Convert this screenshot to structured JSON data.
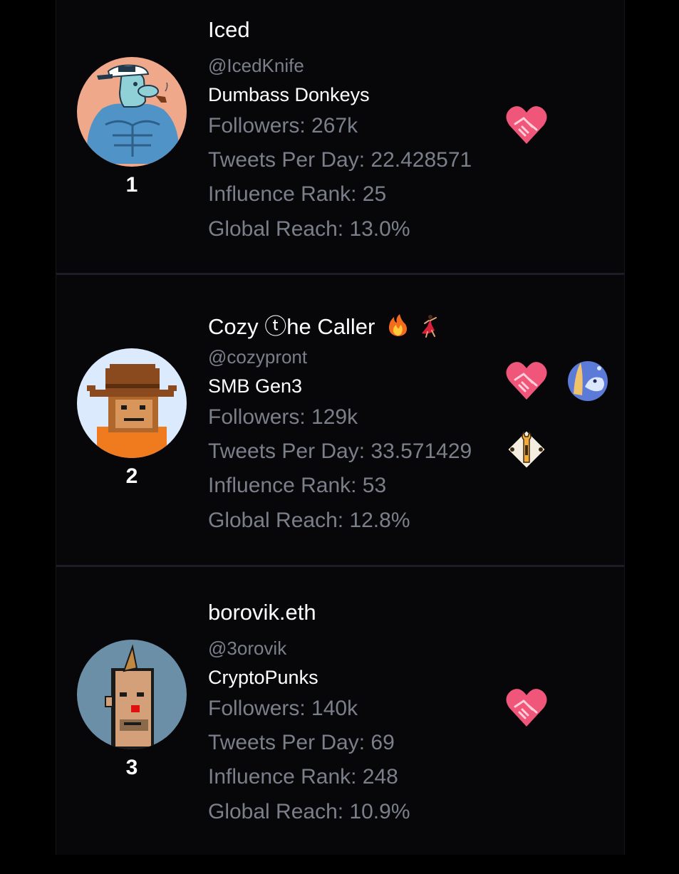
{
  "accounts": [
    {
      "rank": "1",
      "name": "Iced",
      "handle": "@IcedKnife",
      "project": "Dumbass Donkeys",
      "followers": "Followers: 267k",
      "tweets_per_day": "Tweets Per Day: 22.428571",
      "influence_rank": "Influence Rank: 25",
      "global_reach": "Global Reach: 13.0%",
      "badges": [
        "handshake-heart-icon"
      ]
    },
    {
      "rank": "2",
      "name": "Cozy ⓣhe Caller",
      "name_emojis": [
        "fire-icon",
        "dancer-icon"
      ],
      "handle": "@cozypront",
      "project": "SMB Gen3",
      "followers": "Followers: 129k",
      "tweets_per_day": "Tweets Per Day: 33.571429",
      "influence_rank": "Influence Rank: 53",
      "global_reach": "Global Reach: 12.8%",
      "badges": [
        "handshake-heart-icon",
        "whale-icon",
        "wrench-icon"
      ]
    },
    {
      "rank": "3",
      "name": "borovik.eth",
      "handle": "@3orovik",
      "project": "CryptoPunks",
      "followers": "Followers: 140k",
      "tweets_per_day": "Tweets Per Day: 69",
      "influence_rank": "Influence Rank: 248",
      "global_reach": "Global Reach: 10.9%",
      "badges": [
        "handshake-heart-icon"
      ]
    }
  ],
  "colors": {
    "background": "#000000",
    "card": "#07070a",
    "muted_text": "#7b7f8a",
    "heart": "#f0557a"
  }
}
